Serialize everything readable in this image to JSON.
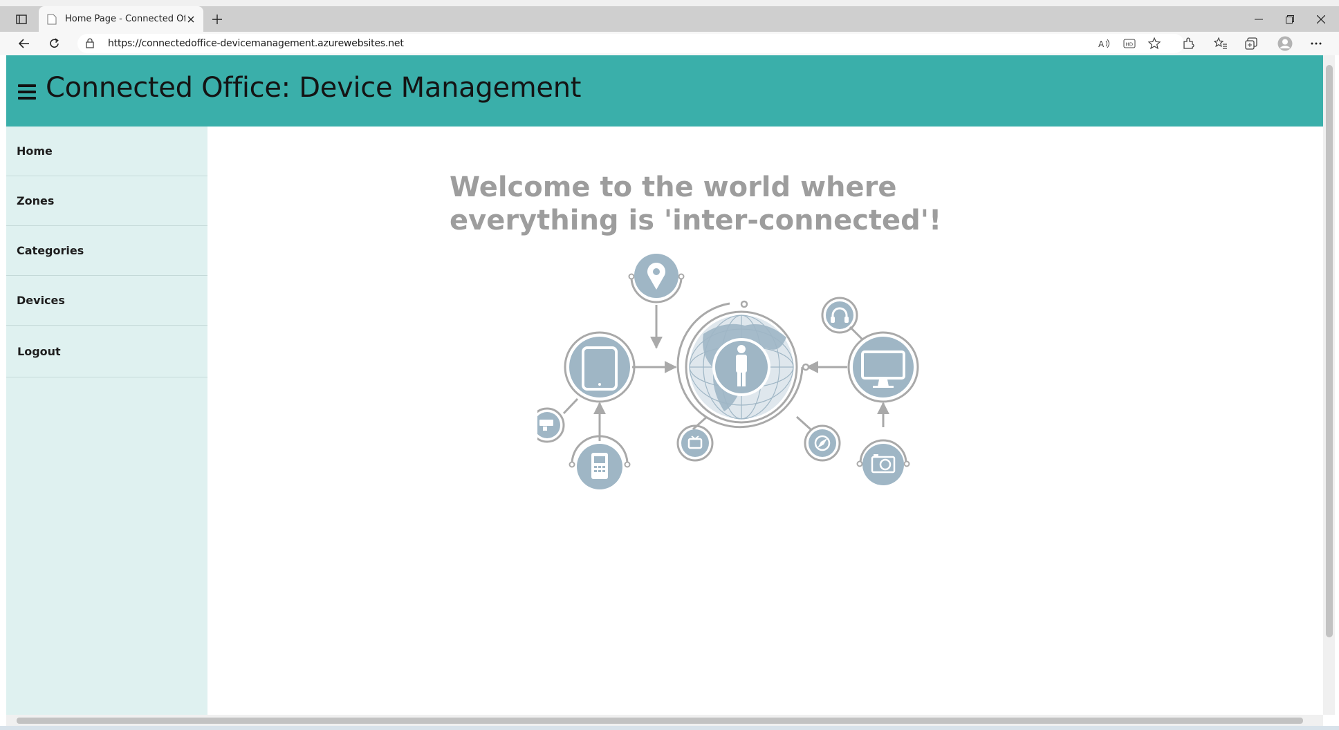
{
  "browser": {
    "tab_title": "Home Page - Connected Office: Device Management",
    "url": "https://connectedoffice-devicemanagement.azurewebsites.net"
  },
  "app": {
    "title": "Connected Office: Device Management"
  },
  "sidebar": {
    "items": [
      {
        "label": "Home"
      },
      {
        "label": "Zones"
      },
      {
        "label": "Categories"
      },
      {
        "label": "Devices"
      },
      {
        "label": "Logout"
      }
    ]
  },
  "main": {
    "welcome_line1": "Welcome to the world where",
    "welcome_line2": "everything is 'inter-connected'!"
  },
  "colors": {
    "header": "#3aafaa",
    "sidebar": "#dff1f0",
    "illustration_fill": "#9fb6c5",
    "illustration_stroke": "#a9a9a9"
  }
}
